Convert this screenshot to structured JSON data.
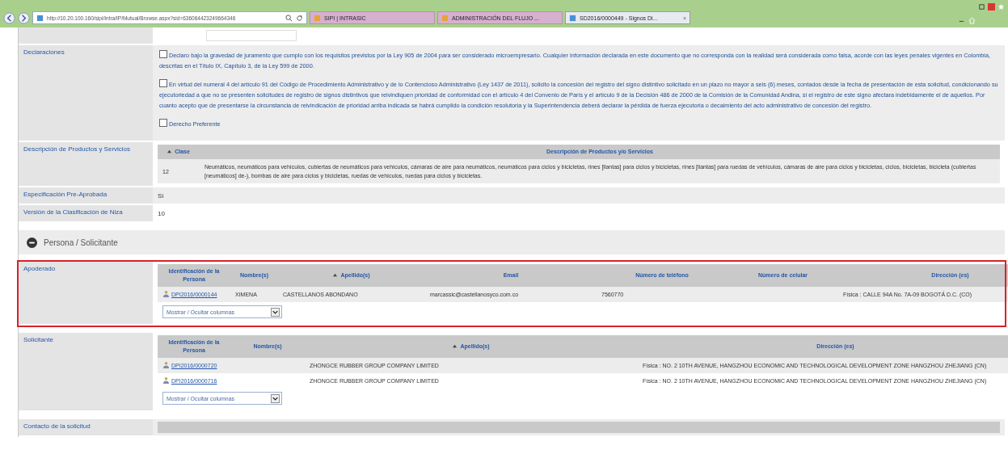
{
  "browser": {
    "url": "http://10.20.100.160/sipi/Intra/IP/Mutual/Browse.aspx?sid=636064423249664346",
    "tabs": [
      {
        "label": "SIPI | INTRASIC",
        "selected": false
      },
      {
        "label": "ADMINISTRACIÓN DEL FLUJO ...",
        "selected": false
      },
      {
        "label": "SD2016/0000449 - Signos Di...",
        "selected": true
      }
    ],
    "tab_close": "×"
  },
  "declaraciones": {
    "label": "Declaraciones",
    "items": [
      {
        "text": "Declaro bajo la gravedad de juramento que cumplo con los requisitos previstos por la Ley 905 de 2004 para ser considerado microempresario. Cualquier información declarada en este documento que no corresponda con la realidad será considerada como falsa, acorde con las leyes penales vigentes en Colombia, descritas en el Título IX, Capítulo 3, de la Ley 599 de 2000.",
        "checked": false
      },
      {
        "text": "En virtud del numeral 4 del artículo 91 del Código de Procedimiento Administrativo y de lo Contencioso Administrativo (Ley 1437 de 2011), solicito la concesión del registro del signo distintivo solicitado en un plazo no mayor a seis (6) meses, contados desde la fecha de presentación de esta solicitud, condicionando su ejecutoriedad a que no se presenten solicitudes de registro de signos distintivos que reivindiquen prioridad de conformidad con el artículo 4 del Convenio de París y el artículo 9 de la Decisión 486 de 2000 de la Comisión de la Comunidad Andina, si el registro de este signo afectara indebidamente el de aquellos. Por cuanto acepto que de presentarse la circunstancia de reivindicación de prioridad arriba indicada se habrá cumplido la condición resolutoria y la Superintendencia deberá declarar la pérdida de fuerza ejecutoria o decaimiento del acto administrativo de concesión del registro.",
        "checked": false
      },
      {
        "text": "Derecho Preferente",
        "checked": false
      }
    ]
  },
  "productos": {
    "label": "Descripción de Productos y Servicios",
    "columns": [
      {
        "label": "Clase",
        "sorted": true
      },
      {
        "label": "Descripción de Productos y/o Servicios",
        "sorted": false
      }
    ],
    "rows": [
      [
        "12",
        "Neumáticos, neumáticos para vehículos, cubiertas de neumáticos para vehículos, cámaras de aire para neumáticos, neumáticos para ciclos y bicicletas, rines [llantas] para ciclos y bicicletas, rines [llantas] para ruedas de vehículos, cámaras de aire para ciclos y bicicletas, ciclos, bicicletas, bicicleta (cubiertas [neumáticos] de-), bombas de aire para ciclos y bicicletas, ruedas de vehículos, ruedas para ciclos y bicicletas."
      ]
    ]
  },
  "fields": [
    {
      "label": "Especificación Pre-Aprobada",
      "value": "Sí"
    },
    {
      "label": "Versión de la Clasificación de Niza",
      "value": "10"
    }
  ],
  "persona_header": {
    "title": "Persona / Solicitante",
    "expanded": true
  },
  "sections": [
    {
      "label": "Apoderado",
      "highlighted": true,
      "columns": [
        {
          "label": "Identificación de la Persona",
          "sorted": false
        },
        {
          "label": "Nombre(s)",
          "sorted": false
        },
        {
          "label": "Apellido(s)",
          "sorted": true
        },
        {
          "label": "Email",
          "sorted": false
        },
        {
          "label": "Número de teléfono",
          "sorted": false
        },
        {
          "label": "Número de celular",
          "sorted": false
        },
        {
          "label": "Dirección (es)",
          "sorted": false
        }
      ],
      "rows": [
        [
          "DPI2016/0000144",
          "XIMENA",
          "CASTELLANOS ABONDANO",
          "marcassic@castellanosyco.com.co",
          "7560770",
          null,
          "Física : CALLE 94A No. 7A-09 BOGOTÁ D.C. (CO)"
        ]
      ],
      "column_toggle": "Mostrar / Ocultar columnas"
    },
    {
      "label": "Solicitante",
      "highlighted": false,
      "columns": [
        {
          "label": "Identificación de la Persona",
          "sorted": false
        },
        {
          "label": "Nombre(s)",
          "sorted": false
        },
        {
          "label": "Apellido(s)",
          "sorted": true
        },
        {
          "label": "Dirección (es)",
          "sorted": false
        }
      ],
      "rows": [
        [
          "DPI2016/0000720",
          null,
          "ZHONGCE RUBBER GROUP COMPANY LIMITED",
          "Física : NO. 2 10TH AVENUE, HANGZHOU ECONOMIC AND TECHNOLOGICAL DEVELOPMENT ZONE HANGZHOU ZHEJIANG (CN)"
        ],
        [
          "DPI2016/0000716",
          null,
          "ZHONGCE RUBBER GROUP COMPANY LIMITED",
          "Física : NO. 2 10TH AVENUE, HANGZHOU ECONOMIC AND TECHNOLOGICAL DEVELOPMENT ZONE HANGZHOU ZHEJIANG (CN)"
        ]
      ],
      "column_toggle": "Mostrar / Ocultar columnas"
    }
  ],
  "next_section": {
    "label": "Contacto de la solicitud"
  }
}
